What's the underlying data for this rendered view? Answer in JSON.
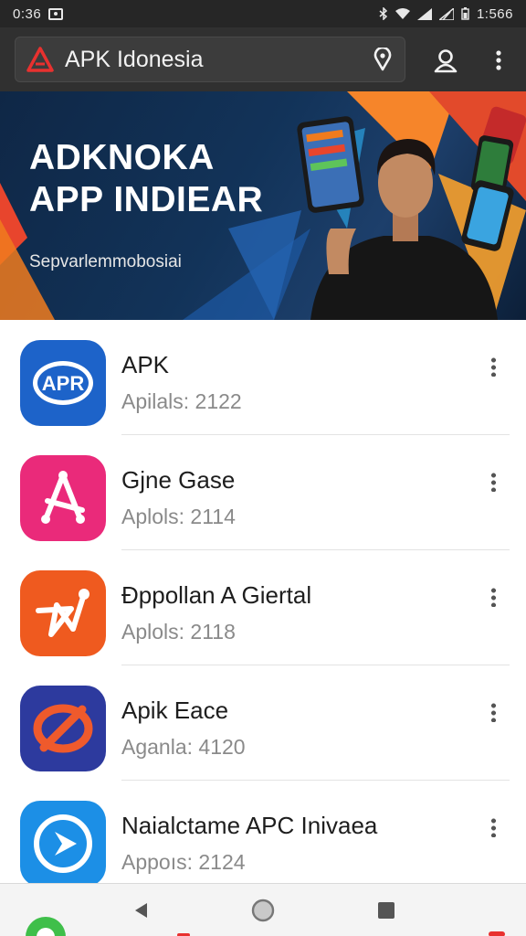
{
  "status_bar": {
    "time": "0:36",
    "battery_text": "1:566"
  },
  "search": {
    "title": "APK Idonesia"
  },
  "banner": {
    "headline_line1": "ADKNOKA",
    "headline_line2": "APP INDIEAR",
    "subtitle": "Sepvarlemmobosiai"
  },
  "apps": [
    {
      "name": "APK",
      "meta": "Apilals: 2122",
      "icon": "apk-logo-icon",
      "color": "#1d63c9"
    },
    {
      "name": "Gjne Gase",
      "meta": "Aplols: 2114",
      "icon": "a-compass-icon",
      "color": "#ea2a7a"
    },
    {
      "name": "Đppollan A Giertal",
      "meta": "Aplols: 2118",
      "icon": "star-pen-icon",
      "color": "#ef5a1f"
    },
    {
      "name": "Apik Eace",
      "meta": "Aganla: 4120",
      "icon": "no-signal-icon",
      "color": "#2d3a9e"
    },
    {
      "name": "Naialctame APC Inivaea",
      "meta": "Appoıs: 2124",
      "icon": "play-circle-icon",
      "color": "#1c8fe6"
    }
  ],
  "colors": {
    "status_bg": "#262626",
    "top_bar_bg": "#303030",
    "banner_bg": "#123359",
    "divider": "#e3e3e3"
  }
}
